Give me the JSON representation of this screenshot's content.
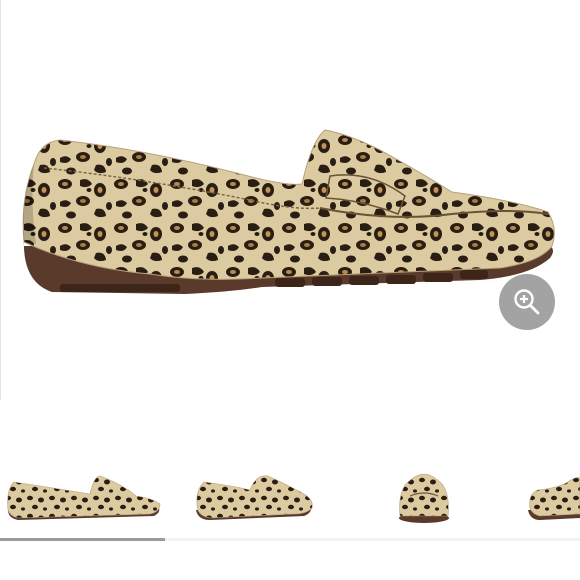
{
  "gallery": {
    "product_image": "leopard-print-loafer",
    "zoom_icon": "zoom-in-icon",
    "thumbnails": [
      {
        "view": "side"
      },
      {
        "view": "angle"
      },
      {
        "view": "front"
      },
      {
        "view": "side-partial"
      }
    ],
    "scroll_progress": 0.285,
    "colors": {
      "base": "#d8c59a",
      "spot": "#2a1d14",
      "tan": "#b98a4e",
      "sole": "#5a3a2a",
      "zoom_bg": "#969696",
      "progress": "#9a9a9a"
    }
  }
}
